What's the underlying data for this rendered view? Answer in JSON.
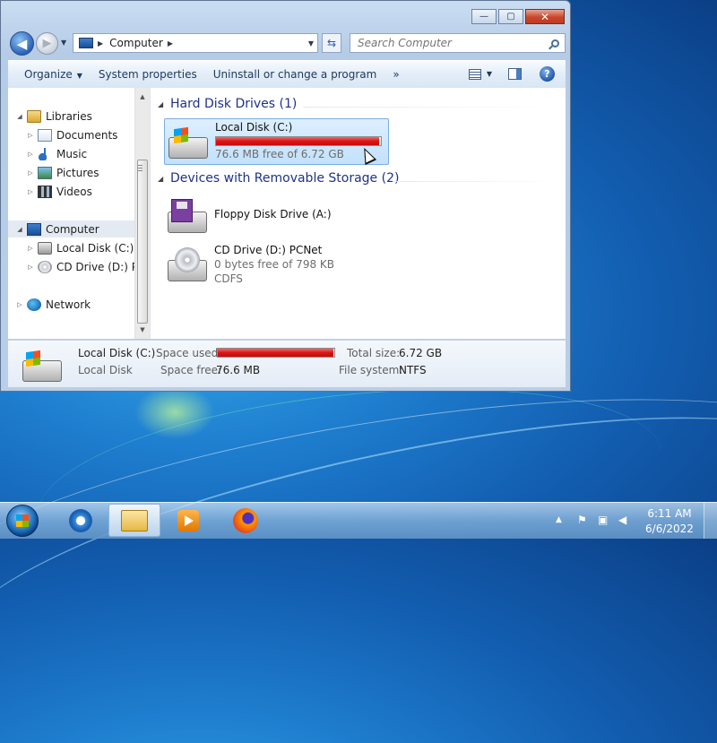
{
  "window": {
    "address": {
      "crumb": "Computer"
    },
    "search": {
      "placeholder": "Search Computer"
    },
    "toolbar": {
      "organize": "Organize",
      "system_properties": "System properties",
      "uninstall": "Uninstall or change a program",
      "more": "»"
    },
    "caption": {
      "minimize": "—",
      "maximize": "▢",
      "close": "✕"
    }
  },
  "nav_pane": {
    "items": [
      {
        "label": "Libraries",
        "icon": "library-icon",
        "expanded": true
      },
      {
        "label": "Documents",
        "icon": "documents-icon"
      },
      {
        "label": "Music",
        "icon": "music-icon"
      },
      {
        "label": "Pictures",
        "icon": "pictures-icon"
      },
      {
        "label": "Videos",
        "icon": "videos-icon"
      },
      {
        "label": "Computer",
        "icon": "computer-icon",
        "selected": true,
        "expanded": true
      },
      {
        "label": "Local Disk (C:)",
        "icon": "hard-drive-icon"
      },
      {
        "label": "CD Drive (D:) PCNet",
        "icon": "cd-drive-icon"
      },
      {
        "label": "Network",
        "icon": "network-icon"
      }
    ]
  },
  "content": {
    "groups": [
      {
        "title": "Hard Disk Drives (1)",
        "drives": [
          {
            "name": "Local Disk (C:)",
            "free_text": "76.6 MB free of 6.72 GB",
            "used_fraction": 0.989,
            "selected": true
          }
        ]
      },
      {
        "title": "Devices with Removable Storage (2)",
        "drives": [
          {
            "name": "Floppy Disk Drive (A:)"
          },
          {
            "name": "CD Drive (D:) PCNet",
            "free_text": "0 bytes free of 798 KB",
            "filesystem": "CDFS"
          }
        ]
      }
    ]
  },
  "details": {
    "name": "Local Disk (C:)",
    "type": "Local Disk",
    "space_used_label": "Space used:",
    "space_free_label": "Space free:",
    "space_free": "76.6 MB",
    "total_size_label": "Total size:",
    "total_size": "6.72 GB",
    "filesystem_label": "File system:",
    "filesystem": "NTFS",
    "used_fraction": 0.989
  },
  "taskbar": {
    "apps": [
      {
        "name": "internet-explorer-icon"
      },
      {
        "name": "windows-explorer-icon",
        "active": true
      },
      {
        "name": "media-player-icon"
      },
      {
        "name": "firefox-icon"
      }
    ],
    "tray": {
      "time": "6:11 AM",
      "date": "6/6/2022"
    }
  },
  "colors": {
    "usage_bar": "#d91515",
    "group_title": "#1e3287",
    "selection": "#c2e1fb"
  }
}
